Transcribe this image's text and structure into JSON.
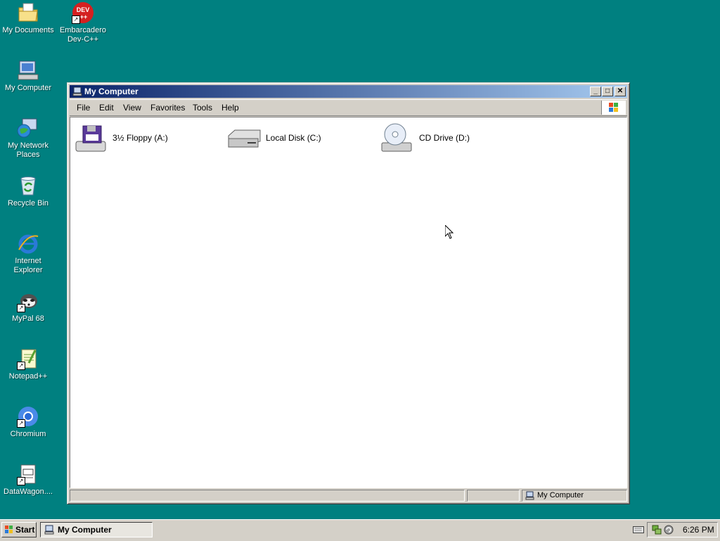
{
  "desktop": {
    "icons": [
      {
        "label": "My Documents"
      },
      {
        "label": "Embarcadero Dev-C++",
        "badge": "DEV\n++"
      },
      {
        "label": "My Computer"
      },
      {
        "label": "My Network Places"
      },
      {
        "label": "Recycle Bin"
      },
      {
        "label": "Internet Explorer"
      },
      {
        "label": "MyPal 68"
      },
      {
        "label": "Notepad++"
      },
      {
        "label": "Chromium"
      },
      {
        "label": "DataWagon...."
      }
    ]
  },
  "window": {
    "title": "My Computer",
    "menu": [
      "File",
      "Edit",
      "View",
      "Favorites",
      "Tools",
      "Help"
    ],
    "drives": [
      {
        "label": "3½ Floppy (A:)",
        "icon": "floppy-drive-icon"
      },
      {
        "label": "Local Disk (C:)",
        "icon": "hard-disk-icon"
      },
      {
        "label": "CD Drive (D:)",
        "icon": "cd-drive-icon"
      }
    ],
    "status": {
      "location": "My Computer"
    }
  },
  "taskbar": {
    "start_label": "Start",
    "task_label": "My Computer",
    "clock": "6:26 PM"
  },
  "colors": {
    "desktop": "#008080",
    "titlebar_start": "#0a246a",
    "titlebar_end": "#a6caf0",
    "chrome": "#d4d0c8"
  }
}
